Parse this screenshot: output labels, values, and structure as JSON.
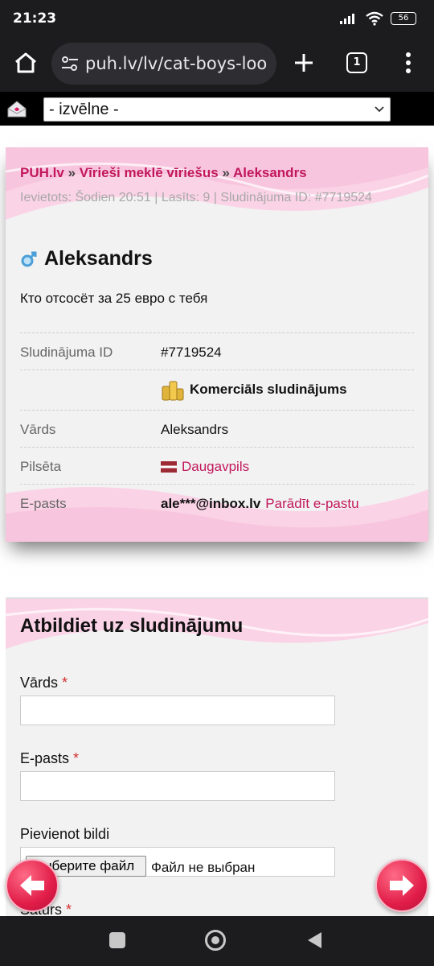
{
  "status_bar": {
    "time": "21:23",
    "battery": "56"
  },
  "browser": {
    "url": "puh.lv/lv/cat-boys-loo",
    "tab_count": "1"
  },
  "site_nav": {
    "select_value": "- izvēlne -"
  },
  "ad": {
    "breadcrumb": {
      "home": "PUH.lv",
      "sep1": "»",
      "category": "Vīrieši meklē vīriešus",
      "sep2": "»",
      "current": "Aleksandrs"
    },
    "meta": "Ievietots: Šodien 20:51 | Lasīts: 9 | Sludinājuma ID: #7719524",
    "title": "Aleksandrs",
    "text": "Кто отсосёт за 25 евро с тебя",
    "details": {
      "id_label": "Sludinājuma ID",
      "id_value": "#7719524",
      "commercial": "Komerciāls sludinājums",
      "name_label": "Vārds",
      "name_value": "Aleksandrs",
      "city_label": "Pilsēta",
      "city_value": "Daugavpils",
      "email_label": "E-pasts",
      "email_value": "ale***@inbox.lv",
      "email_show": "Parādīt e-pastu"
    }
  },
  "reply_form": {
    "title": "Atbildiet uz sludinājumu",
    "name_label": "Vārds",
    "email_label": "E-pasts",
    "photo_label": "Pievienot bildi",
    "file_button": "Выберите файл",
    "file_status": "Файл не выбран",
    "content_label": "Saturs",
    "required_mark": "*"
  },
  "colors": {
    "accent": "#c2185b",
    "arrow": "#e11d48"
  }
}
